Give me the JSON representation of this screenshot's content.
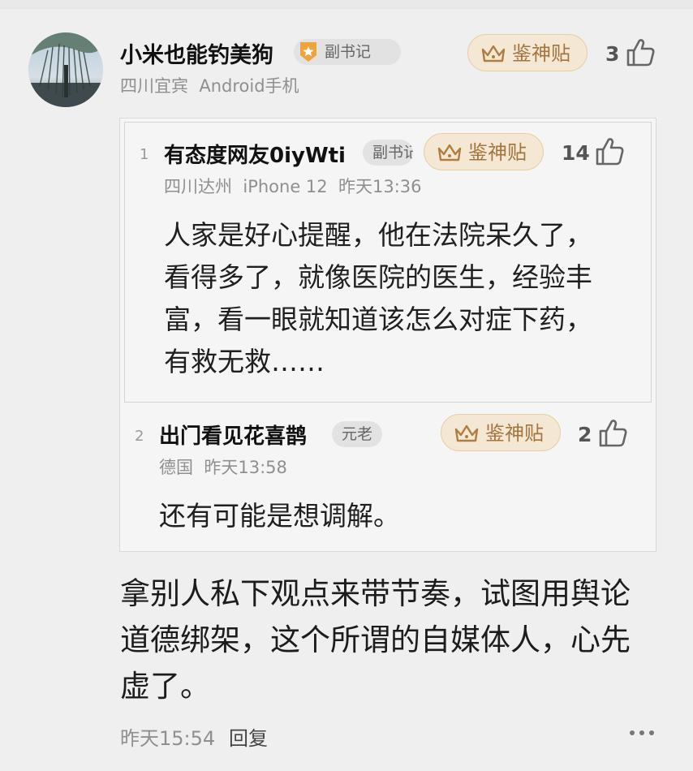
{
  "comment": {
    "author": "小米也能钓美狗",
    "badge": "副书记",
    "location": "四川宜宾",
    "device": "Android手机",
    "god_label": "鉴神贴",
    "likes": "3",
    "text": "拿别人私下观点来带节奏，试图用舆论道德绑架，这个所谓的自媒体人，心先虚了。",
    "time": "昨天15:54",
    "reply_label": "回复"
  },
  "replies": [
    {
      "index": "1",
      "author": "有态度网友0iyWti",
      "badge": "副书记",
      "location": "四川达州",
      "device": "iPhone 12",
      "time": "昨天13:36",
      "god_label": "鉴神贴",
      "likes": "14",
      "text": "人家是好心提醒，他在法院呆久了，看得多了，就像医院的医生，经验丰富，看一眼就知道该怎么对症下药，有救无救……"
    },
    {
      "index": "2",
      "author": "出门看见花喜鹊",
      "badge": "元老",
      "location": "德国",
      "time": "昨天13:58",
      "god_label": "鉴神贴",
      "likes": "2",
      "text": "还有可能是想调解。"
    }
  ],
  "icons": {
    "thumb": "thumbs-up-icon",
    "crown": "crown-icon",
    "more": "more-dots-icon",
    "medal": "medal-icon"
  },
  "colors": {
    "background": "#efefef",
    "god_bg": "#f4e8d4",
    "god_text": "#a3743d",
    "medal": "#f0a23b"
  }
}
